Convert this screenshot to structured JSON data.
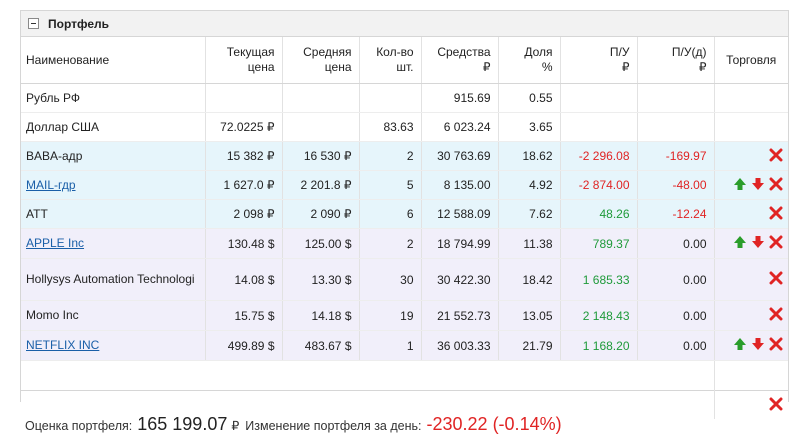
{
  "panel": {
    "title": "Портфель"
  },
  "columns": {
    "name": "Наименование",
    "current_price": [
      "Текущая",
      "цена"
    ],
    "average_price": [
      "Средняя",
      "цена"
    ],
    "quantity": [
      "Кол-во",
      "шт."
    ],
    "funds": [
      "Средства",
      "₽"
    ],
    "share": [
      "Доля",
      "%"
    ],
    "pl": [
      "П/У",
      "₽"
    ],
    "pl_day": [
      "П/У(д)",
      "₽"
    ],
    "trade": "Торговля"
  },
  "rows": [
    {
      "name": "Рубль РФ",
      "link": false,
      "current": "",
      "average": "",
      "qty": "",
      "funds": "915.69",
      "share": "0.55",
      "pl": "",
      "pl_day": "",
      "pl_sign": "",
      "pl_day_sign": "",
      "buy": false,
      "sell": false,
      "close": false,
      "style": "r-cur"
    },
    {
      "name": "Доллар США",
      "link": false,
      "current": "72.0225 ₽",
      "average": "",
      "qty": "83.63",
      "funds": "6 023.24",
      "share": "3.65",
      "pl": "",
      "pl_day": "",
      "pl_sign": "",
      "pl_day_sign": "",
      "buy": false,
      "sell": false,
      "close": false,
      "style": "r-cur"
    },
    {
      "name": "BABA-адр",
      "link": false,
      "current": "15 382 ₽",
      "average": "16 530 ₽",
      "qty": "2",
      "funds": "30 763.69",
      "share": "18.62",
      "pl": "-2 296.08",
      "pl_day": "-169.97",
      "pl_sign": "neg",
      "pl_day_sign": "neg",
      "buy": false,
      "sell": false,
      "close": true,
      "style": "r-blue"
    },
    {
      "name": "MAIL-гдр",
      "link": true,
      "current": "1 627.0 ₽",
      "average": "2 201.8 ₽",
      "qty": "5",
      "funds": "8 135.00",
      "share": "4.92",
      "pl": "-2 874.00",
      "pl_day": "-48.00",
      "pl_sign": "neg",
      "pl_day_sign": "neg",
      "buy": true,
      "sell": true,
      "close": true,
      "style": "r-blue"
    },
    {
      "name": "ATT",
      "link": false,
      "current": "2 098 ₽",
      "average": "2 090 ₽",
      "qty": "6",
      "funds": "12 588.09",
      "share": "7.62",
      "pl": "48.26",
      "pl_day": "-12.24",
      "pl_sign": "pos",
      "pl_day_sign": "neg",
      "buy": false,
      "sell": false,
      "close": true,
      "style": "r-blue"
    },
    {
      "name": "APPLE Inc",
      "link": true,
      "current": "130.48 $",
      "average": "125.00 $",
      "qty": "2",
      "funds": "18 794.99",
      "share": "11.38",
      "pl": "789.37",
      "pl_day": "0.00",
      "pl_sign": "pos",
      "pl_day_sign": "",
      "buy": true,
      "sell": true,
      "close": true,
      "style": "r-lav"
    },
    {
      "name": "Hollysys Automation Technologi",
      "link": false,
      "current": "14.08 $",
      "average": "13.30 $",
      "qty": "30",
      "funds": "30 422.30",
      "share": "18.42",
      "pl": "1 685.33",
      "pl_day": "0.00",
      "pl_sign": "pos",
      "pl_day_sign": "",
      "buy": false,
      "sell": false,
      "close": true,
      "style": "r-lav tall"
    },
    {
      "name": "Momo Inc",
      "link": false,
      "current": "15.75 $",
      "average": "14.18 $",
      "qty": "19",
      "funds": "21 552.73",
      "share": "13.05",
      "pl": "2 148.43",
      "pl_day": "0.00",
      "pl_sign": "pos",
      "pl_day_sign": "",
      "buy": false,
      "sell": false,
      "close": true,
      "style": "r-lav"
    },
    {
      "name": "NETFLIX INC",
      "link": true,
      "current": "499.89 $",
      "average": "483.67 $",
      "qty": "1",
      "funds": "36 003.33",
      "share": "21.79",
      "pl": "1 168.20",
      "pl_day": "0.00",
      "pl_sign": "pos",
      "pl_day_sign": "",
      "buy": true,
      "sell": true,
      "close": true,
      "style": "r-lav"
    }
  ],
  "summary": {
    "valuation_label": "Оценка портфеля:",
    "valuation_value": "165 199.07",
    "valuation_currency": "₽",
    "change_label": "Изменение портфеля за день:",
    "change_value": "-230.22",
    "change_pct": "(-0.14%)"
  },
  "icons": {
    "buy": "arrow-up-icon",
    "sell": "arrow-down-icon",
    "close": "close-icon"
  },
  "colors": {
    "negative": "#e02424",
    "positive": "#1f9a3a",
    "link": "#1a5fa8",
    "buy_arrow": "#2a9d2a",
    "sell_arrow": "#e02424"
  }
}
